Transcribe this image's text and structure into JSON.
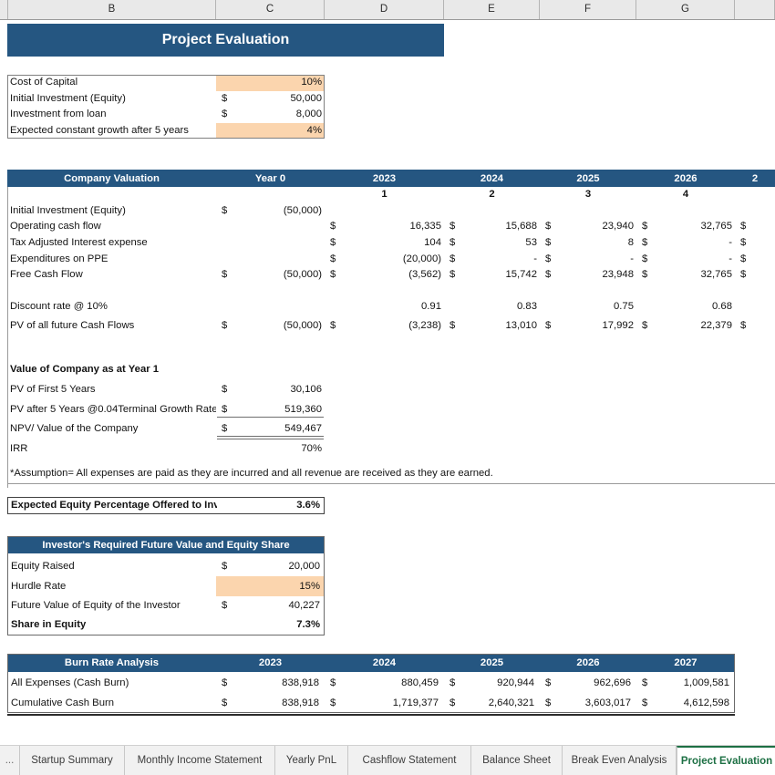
{
  "spreadsheet": {
    "column_headers": [
      "B",
      "C",
      "D",
      "E",
      "F",
      "G"
    ],
    "title_banner": "Project Evaluation"
  },
  "assumptions": {
    "rows": [
      {
        "label": "Cost of Capital",
        "symbol": "",
        "value": "10%",
        "highlight": true
      },
      {
        "label": "Initial Investment (Equity)",
        "symbol": "$",
        "value": "50,000",
        "highlight": false
      },
      {
        "label": "Investment from loan",
        "symbol": "$",
        "value": "8,000",
        "highlight": false
      },
      {
        "label": "Expected constant growth after 5 years",
        "symbol": "",
        "value": "4%",
        "highlight": true
      }
    ]
  },
  "company_valuation": {
    "header_label": "Company Valuation",
    "year0_label": "Year 0",
    "year_headers": [
      "2023",
      "2024",
      "2025",
      "2026",
      "2"
    ],
    "period_numbers": [
      "1",
      "2",
      "3",
      "4"
    ],
    "rows": [
      {
        "label": "Initial Investment (Equity)",
        "year0_symbol": "$",
        "year0_value": "(50,000)",
        "symbols": [
          "",
          "",
          "",
          "",
          ""
        ],
        "values": [
          "",
          "",
          "",
          "",
          ""
        ]
      },
      {
        "label": "Operating cash flow",
        "year0_symbol": "",
        "year0_value": "",
        "symbols": [
          "$",
          "$",
          "$",
          "$",
          "$"
        ],
        "values": [
          "16,335",
          "15,688",
          "23,940",
          "32,765",
          ""
        ]
      },
      {
        "label": "Tax Adjusted Interest expense",
        "year0_symbol": "",
        "year0_value": "",
        "symbols": [
          "$",
          "$",
          "$",
          "$",
          "$"
        ],
        "values": [
          "104",
          "53",
          "8",
          "-",
          ""
        ]
      },
      {
        "label": "Expenditures on PPE",
        "year0_symbol": "",
        "year0_value": "",
        "symbols": [
          "$",
          "$",
          "$",
          "$",
          "$"
        ],
        "values": [
          "(20,000)",
          "-",
          "-",
          "-",
          ""
        ]
      },
      {
        "label": "Free Cash Flow",
        "year0_symbol": "$",
        "year0_value": "(50,000)",
        "symbols": [
          "$",
          "$",
          "$",
          "$",
          "$"
        ],
        "values": [
          "(3,562)",
          "15,742",
          "23,948",
          "32,765",
          ""
        ]
      }
    ],
    "discount_row": {
      "label": "Discount rate @ 10%",
      "year0_symbol": "",
      "year0_value": "",
      "symbols": [
        "",
        "",
        "",
        "",
        ""
      ],
      "values": [
        "0.91",
        "0.83",
        "0.75",
        "0.68",
        ""
      ]
    },
    "pv_row": {
      "label": "PV of all future Cash Flows",
      "year0_symbol": "$",
      "year0_value": "(50,000)",
      "symbols": [
        "$",
        "$",
        "$",
        "$",
        "$"
      ],
      "values": [
        "(3,238)",
        "13,010",
        "17,992",
        "22,379",
        ""
      ]
    }
  },
  "value_of_company": {
    "section_title": "Value of Company as at Year 1",
    "rows": [
      {
        "label": "PV of First 5 Years",
        "symbol": "$",
        "value": "30,106"
      },
      {
        "label": "PV after 5 Years @0.04Terminal Growth Rate",
        "symbol": "$",
        "value": "519,360"
      },
      {
        "label": "NPV/ Value of the Company",
        "symbol": "$",
        "value": "549,467"
      },
      {
        "label": "IRR",
        "symbol": "",
        "value": "70%"
      }
    ],
    "assumption_note": "*Assumption= All expenses are paid as they are incurred and all revenue are received as they are earned."
  },
  "equity_offered": {
    "label": "Expected Equity Percentage Offered to Investors",
    "value": "3.6%"
  },
  "investor_block": {
    "header_label": "Investor's Required Future Value and Equity Share",
    "rows": [
      {
        "label": "Equity Raised",
        "symbol": "$",
        "value": "20,000",
        "highlight": false,
        "bold": false
      },
      {
        "label": "Hurdle Rate",
        "symbol": "",
        "value": "15%",
        "highlight": true,
        "bold": false
      },
      {
        "label": "Future Value of Equity of the Investor",
        "symbol": "$",
        "value": "40,227",
        "highlight": false,
        "bold": false
      },
      {
        "label": "Share in Equity",
        "symbol": "",
        "value": "7.3%",
        "highlight": false,
        "bold": true
      }
    ]
  },
  "burn_rate": {
    "header_label": "Burn Rate Analysis",
    "year_headers": [
      "2023",
      "2024",
      "2025",
      "2026",
      "2027"
    ],
    "rows": [
      {
        "label": "All Expenses (Cash Burn)",
        "symbols": [
          "$",
          "$",
          "$",
          "$",
          "$"
        ],
        "values": [
          "838,918",
          "880,459",
          "920,944",
          "962,696",
          "1,009,581"
        ]
      },
      {
        "label": "Cumulative Cash Burn",
        "symbols": [
          "$",
          "$",
          "$",
          "$",
          "$"
        ],
        "values": [
          "838,918",
          "1,719,377",
          "2,640,321",
          "3,603,017",
          "4,612,598"
        ]
      }
    ]
  },
  "sheet_tabs": {
    "overflow_label": "...",
    "tabs": [
      {
        "label": "Startup Summary",
        "active": false
      },
      {
        "label": "Monthly Income Statement",
        "active": false
      },
      {
        "label": "Yearly PnL",
        "active": false
      },
      {
        "label": "Cashflow Statement",
        "active": false
      },
      {
        "label": "Balance Sheet",
        "active": false
      },
      {
        "label": "Break Even Analysis",
        "active": false
      },
      {
        "label": "Project Evaluation",
        "active": true
      }
    ]
  },
  "colors": {
    "header_blue": "#255681",
    "input_orange": "#fbd5ae",
    "active_tab_green": "#1d7044"
  }
}
